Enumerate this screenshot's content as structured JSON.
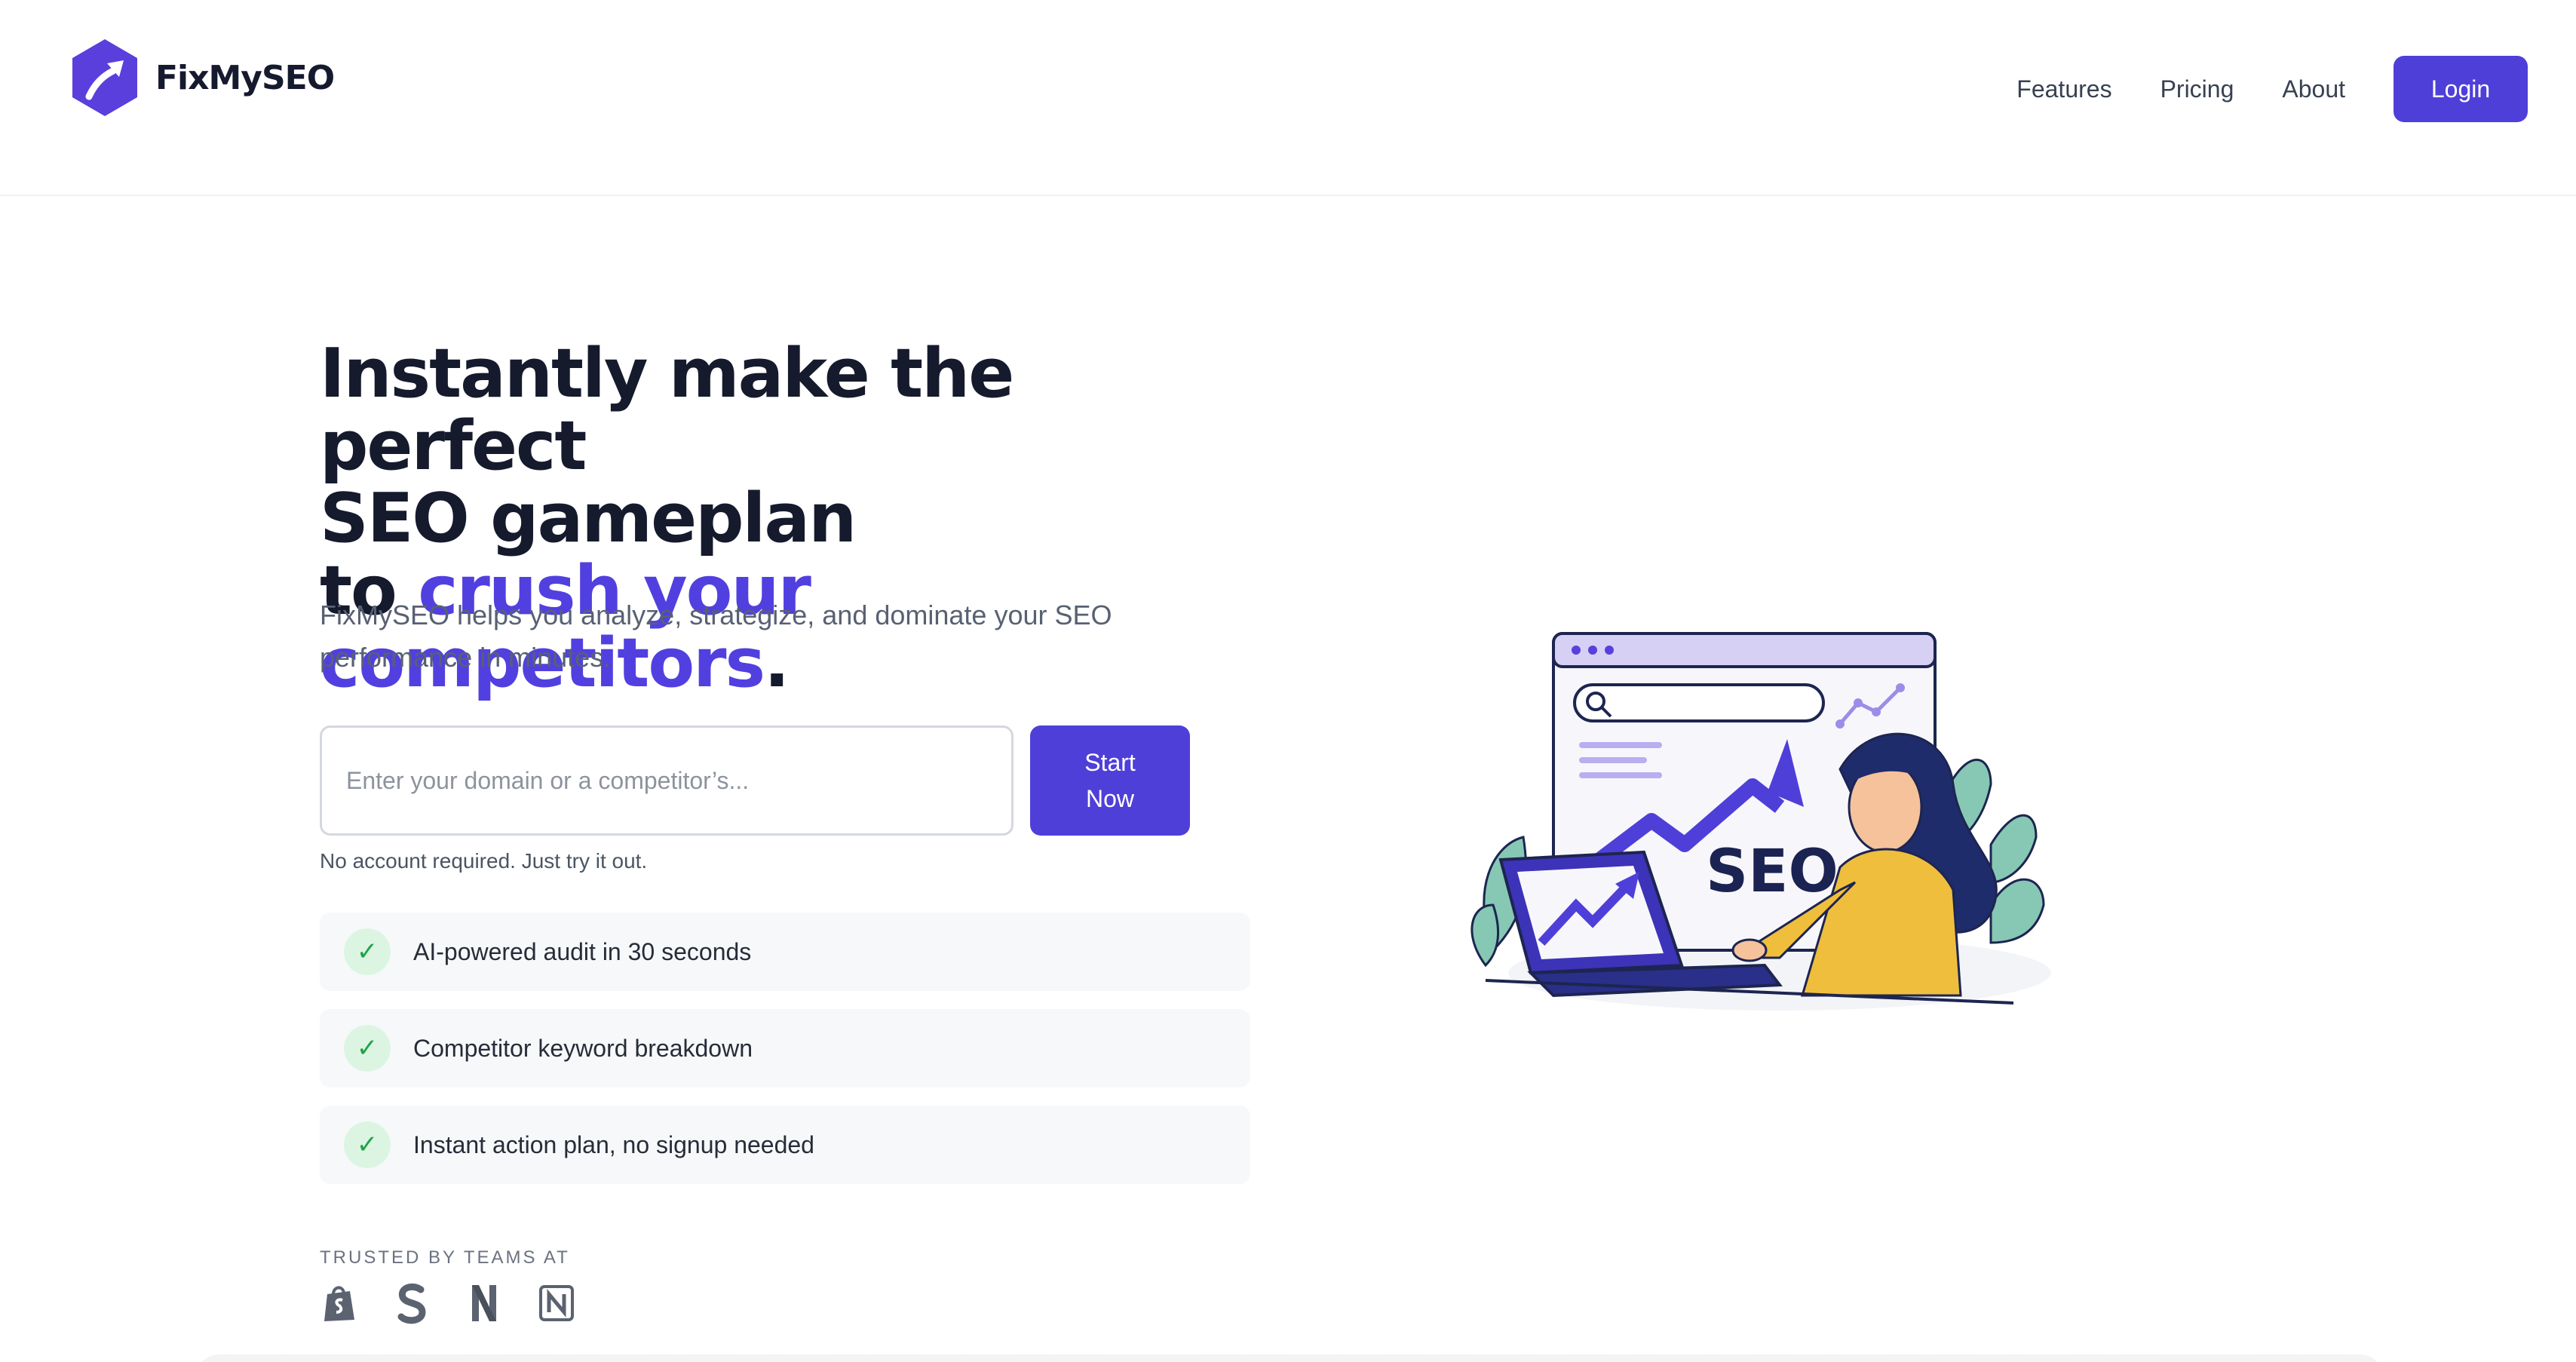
{
  "brand": {
    "name": "FixMySEO"
  },
  "nav": {
    "links": [
      "Features",
      "Pricing",
      "About"
    ],
    "login_label": "Login"
  },
  "hero": {
    "title_line1": "Instantly make the perfect",
    "title_line2": "SEO gameplan",
    "title_line3_prefix": "to ",
    "title_line3_accent": "crush your competitors",
    "title_line3_suffix": ".",
    "subtitle": "FixMySEO helps you analyze, strategize, and dominate your SEO performance in minutes."
  },
  "search": {
    "placeholder": "Enter your domain or a competitor’s...",
    "value": "",
    "button_label": "Start Now",
    "note": "No account required. Just try it out."
  },
  "features": [
    "AI-powered audit in 30 seconds",
    "Competitor keyword breakdown",
    "Instant action plan, no signup needed"
  ],
  "trusted": {
    "label": "TRUSTED BY TEAMS AT",
    "logos": [
      "shopify-icon",
      "squarespace-icon",
      "netflix-icon",
      "notion-icon"
    ]
  },
  "illustration": {
    "seo_label": "SEO"
  },
  "colors": {
    "accent": "#4f3fd9",
    "check_bg": "#dcf5e3",
    "check_fg": "#22a34a"
  }
}
